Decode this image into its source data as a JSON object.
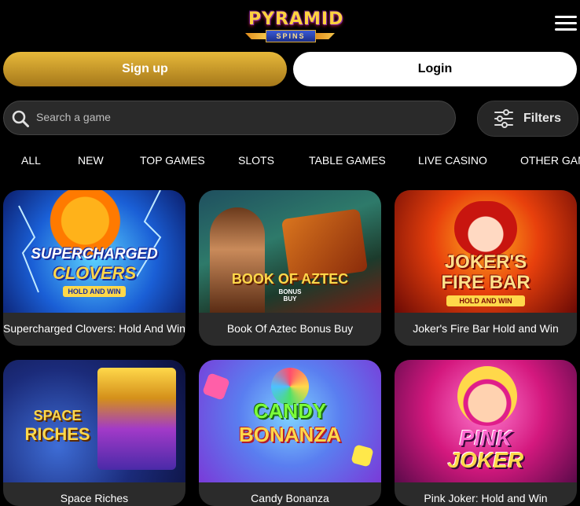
{
  "header": {
    "logo_top": "PYRAMID",
    "logo_bottom": "SPINS"
  },
  "auth": {
    "signup_label": "Sign up",
    "login_label": "Login"
  },
  "search": {
    "placeholder": "Search a game"
  },
  "filters": {
    "label": "Filters"
  },
  "tabs": [
    "ALL",
    "NEW",
    "TOP GAMES",
    "SLOTS",
    "TABLE GAMES",
    "LIVE CASINO",
    "OTHER GAMES"
  ],
  "games": [
    {
      "name": "Supercharged Clovers: Hold And Win",
      "art_line1": "SUPERCHARGED",
      "art_line2": "CLOVERS",
      "art_line3": "HOLD AND WIN"
    },
    {
      "name": "Book Of Aztec Bonus Buy",
      "art_line1": "BOOK OF AZTEC",
      "art_line2": "BONUS",
      "art_line3": "BUY"
    },
    {
      "name": "Joker's Fire Bar Hold and Win",
      "art_line1": "JOKER'S",
      "art_line2": "FIRE BAR",
      "art_line3": "HOLD AND WIN"
    },
    {
      "name": "Space Riches",
      "art_line1": "SPACE",
      "art_line2": "RICHES"
    },
    {
      "name": "Candy Bonanza",
      "art_line1": "CANDY",
      "art_line2": "BONANZA"
    },
    {
      "name": "Pink Joker: Hold and Win",
      "art_line1": "PINK",
      "art_line2": "JOKER"
    }
  ],
  "colors": {
    "background": "#000000",
    "signup_gold": "#d4a22e",
    "card_bg": "#2b2b2b"
  }
}
